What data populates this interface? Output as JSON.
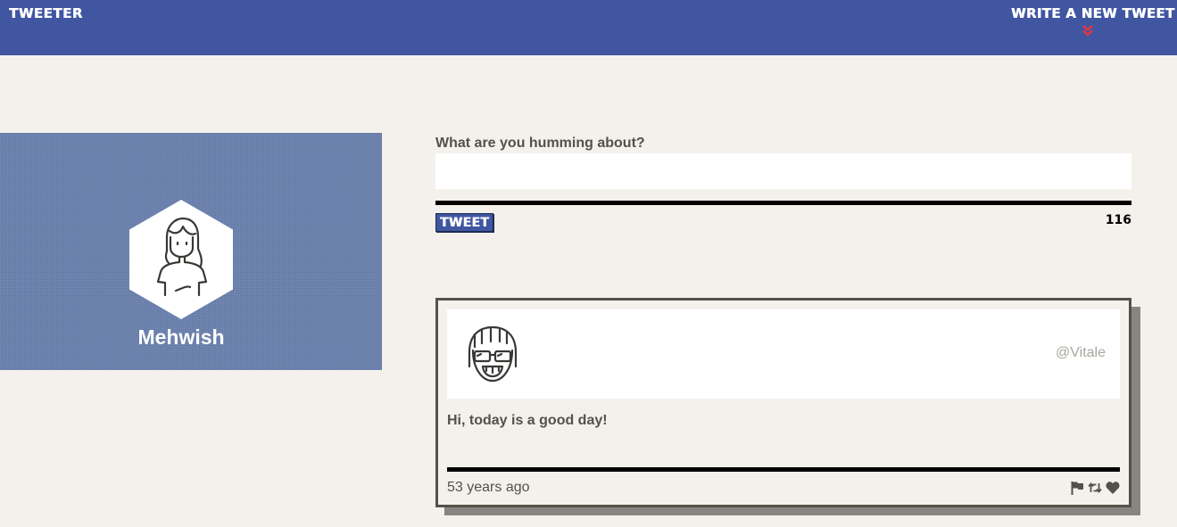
{
  "nav": {
    "brand": "TWEETER",
    "compose_label": "WRITE A NEW TWEET",
    "compose_icon": "double-chevron-down-icon"
  },
  "profile": {
    "name": "Mehwish",
    "avatar_icon": "girl-avatar-icon"
  },
  "compose": {
    "prompt": "What are you humming about?",
    "input_value": "",
    "button_label": "TWEET",
    "counter": "116"
  },
  "tweets": [
    {
      "avatar_icon": "sunglasses-avatar-icon",
      "handle": "@Vitale",
      "text": "Hi, today is a good day!",
      "time": "53 years ago",
      "actions": [
        "flag-icon",
        "retweet-icon",
        "heart-icon"
      ]
    }
  ],
  "colors": {
    "nav_bg": "#4056a1",
    "page_bg": "#f4f1ec",
    "profile_bg": "#6880ae",
    "accent_red": "#e8343f",
    "text": "#545149"
  }
}
